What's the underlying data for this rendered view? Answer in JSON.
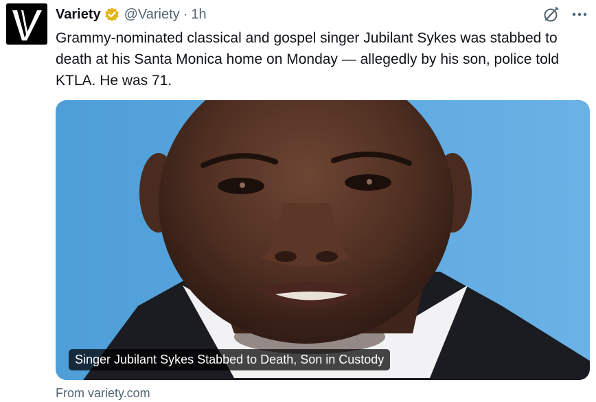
{
  "author": {
    "display_name": "Variety",
    "handle": "@Variety",
    "separator": "·",
    "time": "1h",
    "avatar_letter": "V",
    "verified_badge_color": "#e2b719"
  },
  "tweet": {
    "text": "Grammy-nominated classical and gospel singer Jubilant Sykes was stabbed to death at his Santa Monica home on Monday — allegedly by his son, police told KTLA. He was 71."
  },
  "card": {
    "title": "Singer Jubilant Sykes Stabbed to Death, Son in Custody",
    "source": "From variety.com",
    "image_background_color": "#5fa8dd"
  },
  "icons": {
    "grok": "grok-icon",
    "more": "more-icon",
    "verified": "verified-badge-icon"
  }
}
